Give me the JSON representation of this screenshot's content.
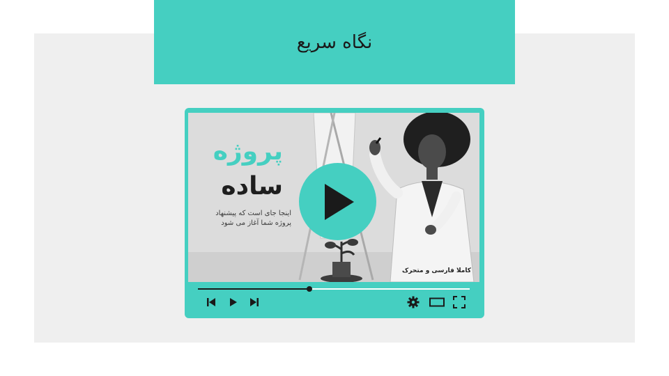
{
  "header": {
    "title": "نگاه سریع"
  },
  "video": {
    "heading_line1": "پروژه",
    "heading_line2": "ساده",
    "description": "اینجا جای است که پیشنهاد پروژه شما آغاز می شود",
    "caption": "کاملا فارسی و متحرک",
    "progress_fraction": 0.41
  },
  "icons": {
    "big_play": "play-icon",
    "previous": "skip-previous-icon",
    "play": "play-icon",
    "next": "skip-next-icon",
    "settings": "gear-icon",
    "theater": "theater-mode-icon",
    "fullscreen": "fullscreen-icon"
  },
  "colors": {
    "accent": "#45cfc1",
    "panel": "#efefef",
    "dark": "#1a1a1a"
  }
}
